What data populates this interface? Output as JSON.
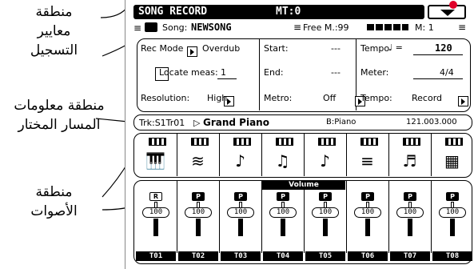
{
  "annotations": {
    "params_area": "منطقة\nمعايير\nالتسجيل",
    "track_info_area": "منطقة معلومات\nالمسار المختار",
    "sounds_area": "منطقة\nالأصوات"
  },
  "title_bar": {
    "title": "SONG RECORD",
    "measure_label": "MT:0"
  },
  "song_row": {
    "song_label": "Song:",
    "song_name": "NEWSONG",
    "free": "Free M.:99",
    "measure": "M: 1"
  },
  "params": {
    "rec_mode_label": "Rec Mode",
    "rec_mode_value": "Overdub",
    "locate_label": "Locate meas:",
    "locate_value": "1",
    "resolution_label": "Resolution:",
    "resolution_value": "High",
    "start_label": "Start:",
    "start_value": "---",
    "end_label": "End:",
    "end_value": "---",
    "metro_label": "Metro:",
    "metro_value": "Off",
    "tempo_label": "Tempo",
    "tempo_note": "♩ =",
    "tempo_value": "120",
    "meter_label": "Meter:",
    "meter_value": "4/4",
    "tempo_mode_label": "Tempo:",
    "tempo_mode_value": "Record"
  },
  "track_info": {
    "track": "Trk:S1Tr01",
    "sound": "Grand Piano",
    "bank": "B:Piano",
    "program": "121.003.000"
  },
  "sounds": {
    "volume_header": "Volume",
    "tracks": [
      {
        "id": "T01",
        "mode": "R",
        "volume": "100",
        "icon": "piano-icon"
      },
      {
        "id": "T02",
        "mode": "P",
        "volume": "100",
        "icon": "harmonica-icon"
      },
      {
        "id": "T03",
        "mode": "P",
        "volume": "100",
        "icon": "acoustic-guitar-icon"
      },
      {
        "id": "T04",
        "mode": "P",
        "volume": "100",
        "icon": "saxophone-icon"
      },
      {
        "id": "T05",
        "mode": "P",
        "volume": "100",
        "icon": "acoustic-guitar-icon"
      },
      {
        "id": "T06",
        "mode": "P",
        "volume": "100",
        "icon": "strings-icon"
      },
      {
        "id": "T07",
        "mode": "P",
        "volume": "100",
        "icon": "bass-guitar-icon"
      },
      {
        "id": "T08",
        "mode": "P",
        "volume": "100",
        "icon": "synth-keyboard-icon"
      }
    ]
  }
}
